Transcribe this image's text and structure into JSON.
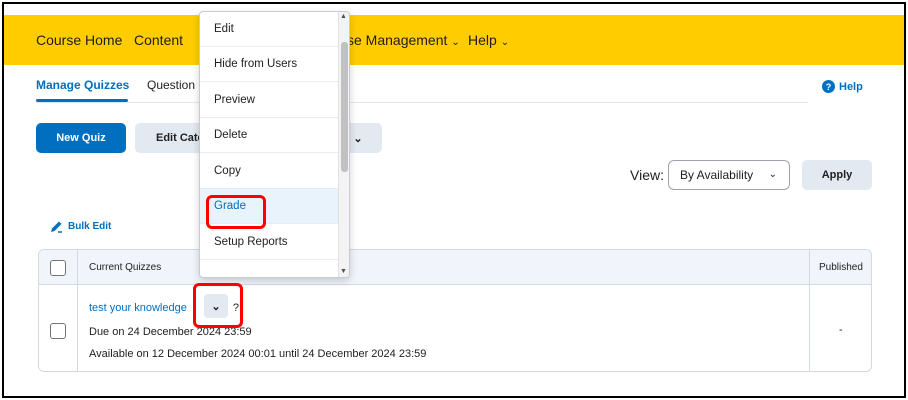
{
  "nav": {
    "course_home": "Course Home",
    "content": "Content",
    "course_management": "se Management",
    "help": "Help"
  },
  "tabs": {
    "manage_quizzes": "Manage Quizzes",
    "question": "Question"
  },
  "help_link": "Help",
  "buttons": {
    "new_quiz": "New Quiz",
    "edit_categories": "Edit Cate",
    "apply": "Apply"
  },
  "view": {
    "label": "View:",
    "selected": "By Availability"
  },
  "bulk_edit": "Bulk Edit",
  "table": {
    "headers": {
      "current_quizzes": "Current Quizzes",
      "published": "Published"
    },
    "row": {
      "title": "test your knowledge",
      "title_suffix": "?",
      "due": "Due on 24 December 2024 23:59",
      "available": "Available on 12 December 2024 00:01 until 24 December 2024 23:59",
      "published": "-"
    }
  },
  "menu": {
    "items": [
      "Edit",
      "Hide from Users",
      "Preview",
      "Delete",
      "Copy",
      "Grade",
      "Setup Reports"
    ]
  },
  "colors": {
    "brand_yellow": "#ffcc00",
    "primary_blue": "#006fbf",
    "highlight_red": "#ff0000"
  }
}
